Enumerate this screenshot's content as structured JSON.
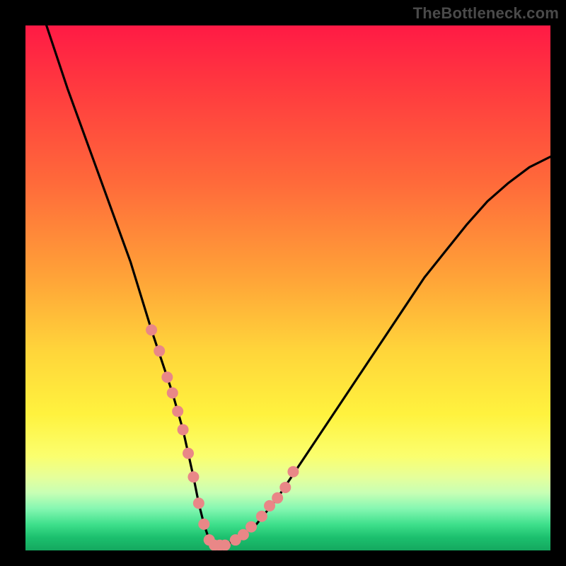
{
  "watermark": "TheBottleneck.com",
  "colors": {
    "frame": "#000000",
    "curve": "#000000",
    "marker": "#e98787",
    "gradient_top": "#ff1a45",
    "gradient_bottom": "#14a85f"
  },
  "chart_data": {
    "type": "line",
    "title": "",
    "xlabel": "",
    "ylabel": "",
    "xlim": [
      0,
      100
    ],
    "ylim": [
      0,
      100
    ],
    "grid": false,
    "legend": false,
    "series": [
      {
        "name": "curve",
        "note": "V-shaped bottleneck curve; y is percent height (0=bottom, 100=top). Values estimated from plot.",
        "x": [
          4,
          8,
          12,
          16,
          20,
          24,
          26,
          28,
          30,
          32,
          33,
          34,
          35,
          36,
          38,
          40,
          44,
          48,
          52,
          56,
          60,
          64,
          68,
          72,
          76,
          80,
          84,
          88,
          92,
          96,
          100
        ],
        "y": [
          100,
          88,
          77,
          66,
          55,
          42,
          36,
          30,
          23,
          14,
          9,
          5,
          2,
          1,
          1,
          2,
          5,
          10,
          16,
          22,
          28,
          34,
          40,
          46,
          52,
          57,
          62,
          66.5,
          70,
          73,
          75
        ]
      },
      {
        "name": "markers",
        "note": "Highlighted sample points along the curve near the minimum.",
        "x": [
          24,
          25.5,
          27,
          28,
          29,
          30,
          31,
          32,
          33,
          34,
          35,
          36,
          37,
          38,
          40,
          41.5,
          43,
          45,
          46.5,
          48,
          49.5,
          51
        ],
        "y": [
          42,
          38,
          33,
          30,
          26.5,
          23,
          18.5,
          14,
          9,
          5,
          2,
          1,
          1,
          1,
          2,
          3,
          4.5,
          6.5,
          8.5,
          10,
          12,
          15
        ]
      }
    ]
  }
}
